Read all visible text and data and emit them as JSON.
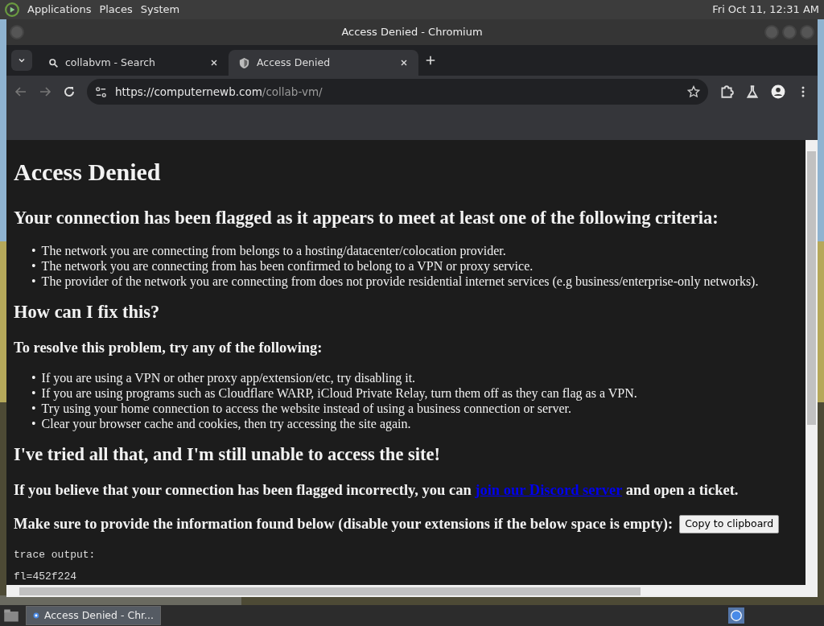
{
  "top_panel": {
    "menus": [
      "Applications",
      "Places",
      "System"
    ],
    "clock": "Fri Oct 11, 12:31 AM"
  },
  "window": {
    "title": "Access Denied - Chromium"
  },
  "tabs": [
    {
      "label": "collabvm - Search",
      "selected": false,
      "kind": "search"
    },
    {
      "label": "Access Denied",
      "selected": true,
      "kind": "site"
    }
  ],
  "address": {
    "host": "https://computernewb.com",
    "path": "/collab-vm/"
  },
  "page": {
    "title": "Access Denied",
    "heading": "Your connection has been flagged as it appears to meet at least one of the following criteria:",
    "criteria": [
      {
        "bullet": "•",
        "text": "The network you are connecting from belongs to a hosting/datacenter/colocation provider."
      },
      {
        "bullet": "•",
        "text": "The network you are connecting from has been confirmed to belong to a VPN or proxy service."
      },
      {
        "bullet": "•",
        "text": "The provider of the network you are connecting from does not provide residential internet services (e.g business/enterprise-only networks)."
      }
    ],
    "fix_heading": "How can I fix this?",
    "resolve_heading": "To resolve this problem, try any of the following:",
    "steps": [
      {
        "bullet": "•",
        "text": "If you are using a VPN or other proxy app/extension/etc, try disabling it."
      },
      {
        "bullet": "•",
        "text": "If you are using programs such as Cloudflare WARP, iCloud Private Relay, turn them off as they can flag as a VPN."
      },
      {
        "bullet": "•",
        "text": "Try using your home connection to access the website instead of using a business connection or server."
      },
      {
        "bullet": "•",
        "text": "Clear your browser cache and cookies, then try accessing the site again."
      }
    ],
    "tried_heading": "I've tried all that, and I'm still unable to access the site!",
    "discord": {
      "before": "If you believe that your connection has been flagged incorrectly, you can",
      "link": "join our Discord server",
      "after": "and open a ticket."
    },
    "provide": "Make sure to provide the information found below (disable your extensions if the below space is empty):",
    "copy_button": "Copy to clipboard",
    "trace": [
      "trace output:",
      "fl=452f224"
    ]
  },
  "taskbar": {
    "items": [
      {
        "label": "Access Denied - Chr...",
        "selected": true
      }
    ]
  }
}
